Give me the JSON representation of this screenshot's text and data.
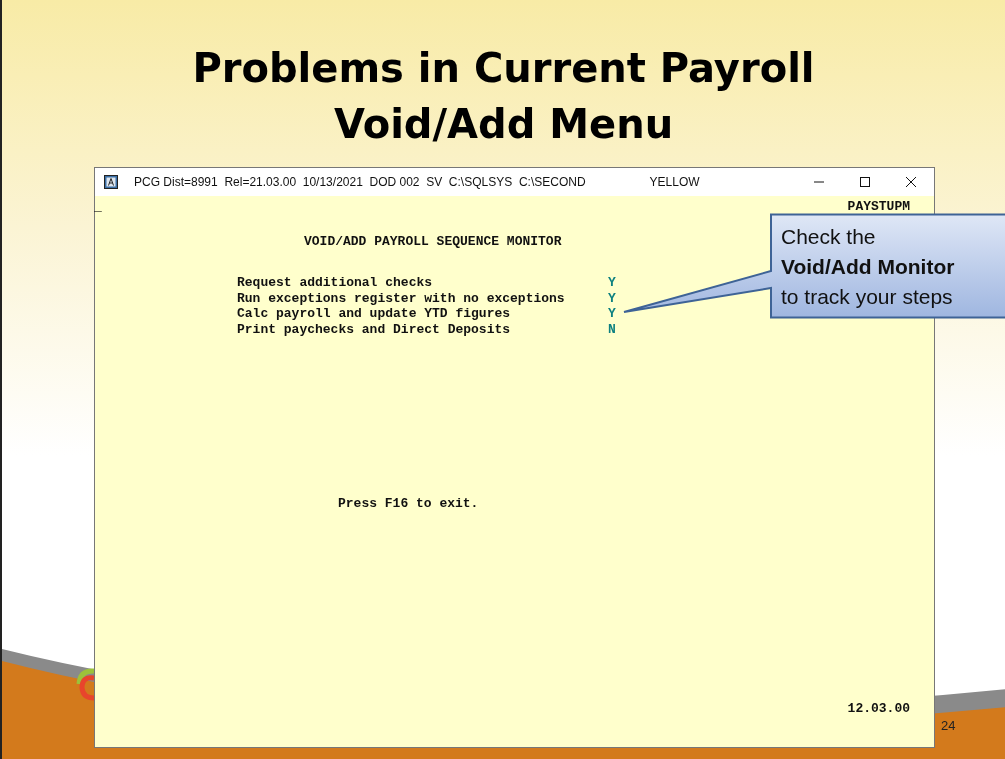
{
  "slide": {
    "title_lines": [
      "Problems in Current Payroll",
      "Void/Add Menu"
    ],
    "page_number": "24"
  },
  "window": {
    "title": "PCG Dist=8991  Rel=21.03.00  10/13/2021  DOD 002  SV  C:\\SQLSYS  C:\\SECOND",
    "theme_label": "YELLOW"
  },
  "terminal": {
    "cursor": "_",
    "program_id": "PAYSTUPM",
    "heading": "VOID/ADD PAYROLL SEQUENCE MONITOR",
    "steps": [
      {
        "label": "Request additional checks",
        "flag": "Y"
      },
      {
        "label": "Run exceptions register with no exceptions",
        "flag": "Y"
      },
      {
        "label": "Calc payroll and update YTD figures",
        "flag": "Y"
      },
      {
        "label": "Print paychecks and Direct Deposits",
        "flag": "N"
      }
    ],
    "exit_hint": "Press F16 to exit.",
    "version": "12.03.00"
  },
  "callout": {
    "text": "Check the\n**Void/Add Monitor**\nto track your steps"
  }
}
